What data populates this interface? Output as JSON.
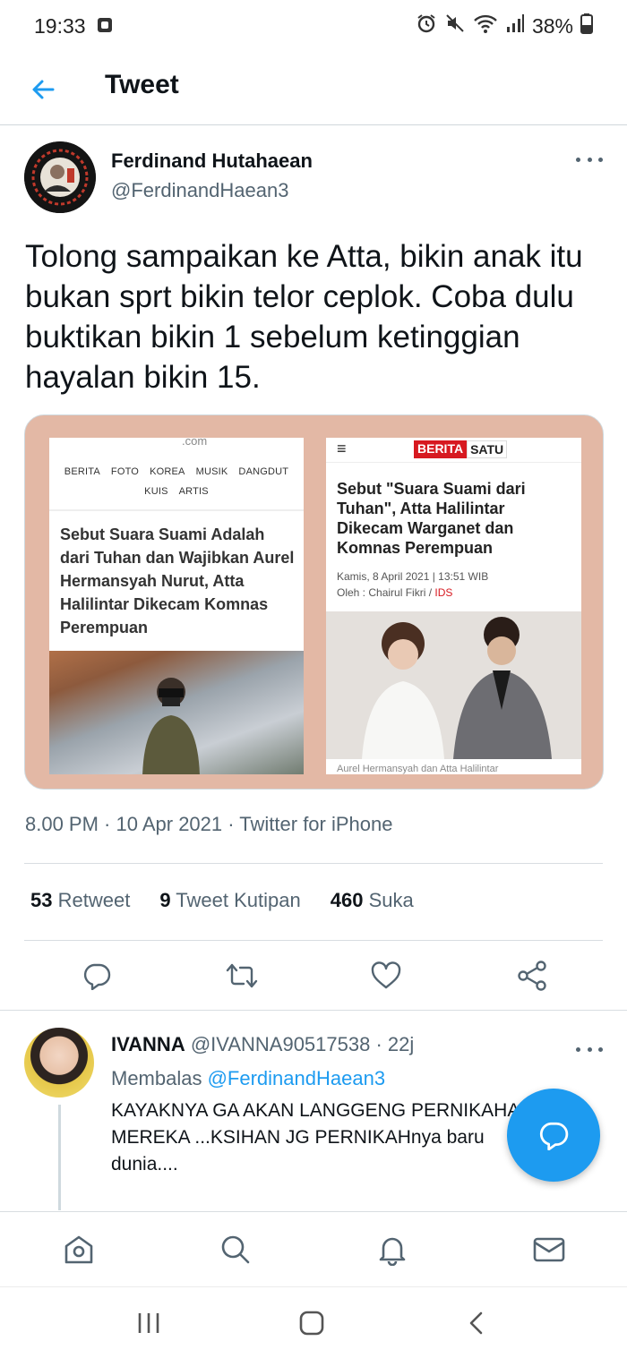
{
  "status_bar": {
    "time": "19:33",
    "battery": "38%",
    "icons": [
      "screenshot-icon",
      "alarm-icon",
      "mute-icon",
      "wifi-icon",
      "signal-icon",
      "battery-icon"
    ]
  },
  "header": {
    "title": "Tweet",
    "back_icon": "arrow-left-icon"
  },
  "tweet": {
    "author_name": "Ferdinand Hutahaean",
    "author_handle": "@FerdinandHaean3",
    "text": "Tolong sampaikan ke Atta, bikin anak itu bukan sprt bikin telor ceplok. Coba dulu buktikan bikin 1 sebelum ketinggian hayalan bikin 15.",
    "media": {
      "left_card": {
        "logo": ".com",
        "nav": [
          "BERITA",
          "FOTO",
          "KOREA",
          "MUSIK",
          "DANGDUT",
          "KUIS",
          "ARTIS"
        ],
        "headline": "Sebut Suara Suami Adalah dari Tuhan dan Wajibkan Aurel Hermansyah Nurut, Atta Halilintar Dikecam Komnas Perempuan"
      },
      "right_card": {
        "menu_icon": "≡",
        "logo_left": "BERITA",
        "logo_right": "SATU",
        "headline": "Sebut \"Suara Suami dari Tuhan\", Atta Halilintar Dikecam Warganet dan Komnas Perempuan",
        "date": "Kamis, 8 April 2021 | 13:51 WIB",
        "author_prefix": "Oleh : Chairul Fikri / ",
        "author_tag": "IDS",
        "caption": "Aurel Hermansyah dan Atta Halilintar"
      }
    },
    "timestamp": "8.00 PM · 10 Apr 2021 · Twitter for iPhone",
    "stats": {
      "retweets": "53",
      "retweets_label": "Retweet",
      "quotes": "9",
      "quotes_label": "Tweet Kutipan",
      "likes": "460",
      "likes_label": "Suka"
    }
  },
  "reply": {
    "name": "IVANNA",
    "handle_time": "@IVANNA90517538 · 22j",
    "replying_prefix": "Membalas ",
    "replying_to": "@FerdinandHaean3",
    "text": "KAYAKNYA  GA AKAN  LANGGENG  PERNIKAHAN\nMEREKA  ...KSIHAN  JG PERNIKAHnya baru\ndunia...."
  },
  "colors": {
    "accent": "#1d9bf0",
    "text": "#0f1419",
    "secondary": "#536471",
    "media_bg": "#e3b8a5"
  }
}
